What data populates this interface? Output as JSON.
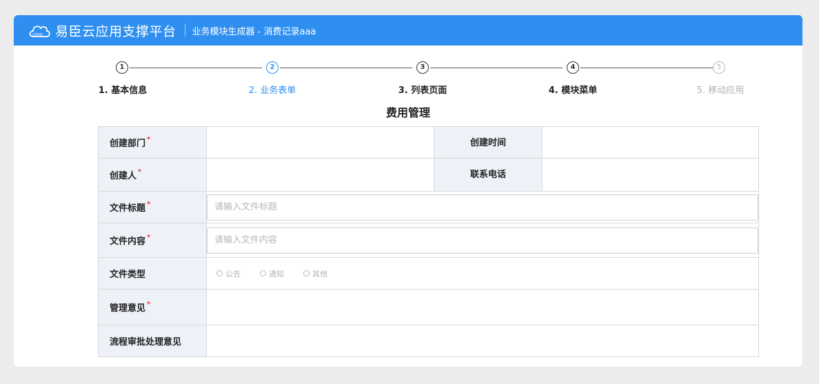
{
  "app": {
    "brand": "易臣云应用支撑平台",
    "module_title": "业务模块生成器 - 消费记录aaa",
    "brand_color": "#2f8ff0"
  },
  "steps": [
    {
      "num": "1",
      "label": "1. 基本信息",
      "state": "done"
    },
    {
      "num": "2",
      "label": "2. 业务表单",
      "state": "active"
    },
    {
      "num": "3",
      "label": "3. 列表页面",
      "state": "done"
    },
    {
      "num": "4",
      "label": "4. 模块菜单",
      "state": "done"
    },
    {
      "num": "5",
      "label": "5. 移动应用",
      "state": "disabled"
    }
  ],
  "form": {
    "title": "费用管理",
    "dept_label": "创建部门",
    "create_time_label": "创建时间",
    "creator_label": "创建人",
    "phone_label": "联系电话",
    "file_title_label": "文件标题",
    "file_title_placeholder": "请输入文件标题",
    "file_content_label": "文件内容",
    "file_content_placeholder": "请输入文件内容",
    "file_type_label": "文件类型",
    "file_type_options": [
      "公告",
      "通知",
      "其他"
    ],
    "opinion_label": "管理意见",
    "process_label": "流程审批处理意见",
    "required_mark": "*"
  }
}
